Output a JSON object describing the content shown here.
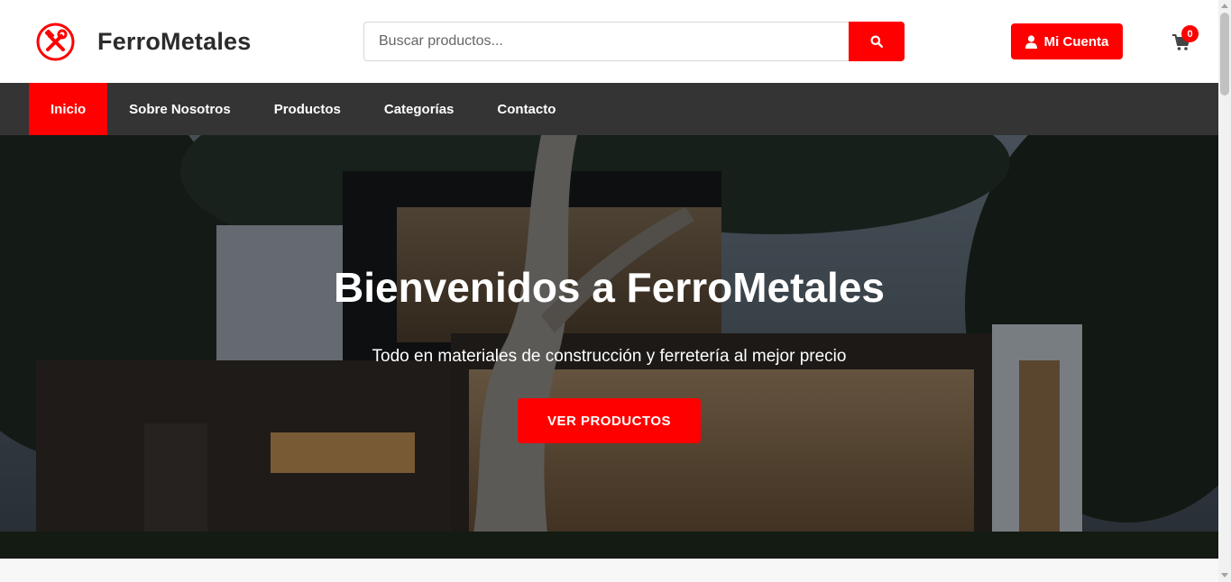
{
  "brand": {
    "name": "FerroMetales",
    "logo_icon": "hammer-wrench-icon",
    "accent": "#ff0000"
  },
  "search": {
    "placeholder": "Buscar productos...",
    "value": "",
    "button_icon": "search-icon"
  },
  "account": {
    "label": "Mi Cuenta",
    "icon": "user-icon"
  },
  "cart": {
    "icon": "cart-icon",
    "count": "0"
  },
  "nav": {
    "items": [
      {
        "label": "Inicio",
        "active": true
      },
      {
        "label": "Sobre Nosotros",
        "active": false
      },
      {
        "label": "Productos",
        "active": false
      },
      {
        "label": "Categorías",
        "active": false
      },
      {
        "label": "Contacto",
        "active": false
      }
    ],
    "background": "#343434"
  },
  "hero": {
    "title": "Bienvenidos a FerroMetales",
    "subtitle": "Todo en materiales de construcción y ferretería al mejor precio",
    "button_label": "VER PRODUCTOS"
  }
}
